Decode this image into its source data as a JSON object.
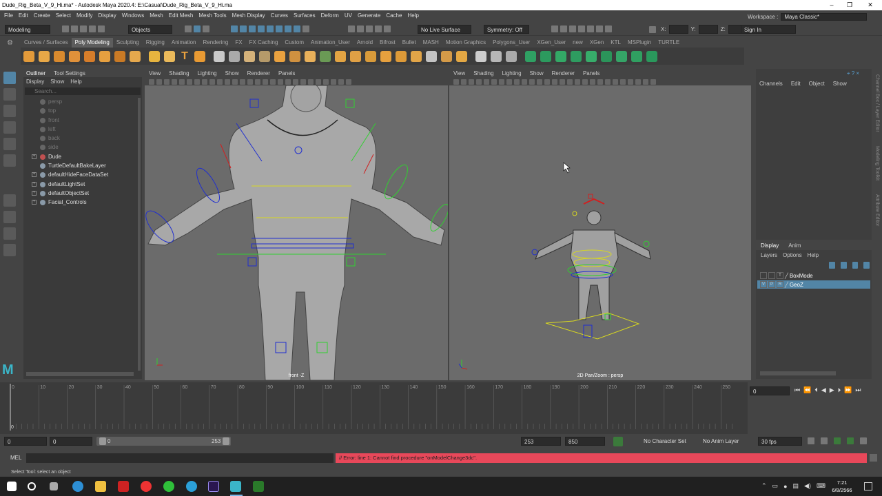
{
  "window": {
    "title": "Dude_Rig_Beta_V_9_Hi.ma* - Autodesk Maya 2020.4: E:\\Casual\\Dude_Rig_Beta_V_9_Hi.ma"
  },
  "menubar": [
    "File",
    "Edit",
    "Create",
    "Select",
    "Modify",
    "Display",
    "Windows",
    "Mesh",
    "Edit Mesh",
    "Mesh Tools",
    "Mesh Display",
    "Curves",
    "Surfaces",
    "Deform",
    "UV",
    "Generate",
    "Cache",
    "Help"
  ],
  "statusline": {
    "mode": "Modeling",
    "select_mode": "Objects",
    "live_surface": "No Live Surface",
    "symmetry": "Symmetry: Off",
    "x_label": "X:",
    "y_label": "Y:",
    "z_label": "Z:",
    "sign_in": "Sign In"
  },
  "workspace": {
    "label": "Workspace :",
    "value": "Maya Classic*"
  },
  "shelf_tabs": [
    "Curves / Surfaces",
    "Poly Modeling",
    "Sculpting",
    "Rigging",
    "Animation",
    "Rendering",
    "FX",
    "FX Caching",
    "Custom",
    "Animation_User",
    "Arnold",
    "Bifrost",
    "Bullet",
    "MASH",
    "Motion Graphics",
    "Polygons_User",
    "XGen_User",
    "new",
    "XGen",
    "KTL",
    "MSPlugin",
    "TURTLE"
  ],
  "outliner": {
    "tabs": [
      "Outliner",
      "Tool Settings"
    ],
    "menu": [
      "Display",
      "Show",
      "Help"
    ],
    "search_placeholder": "Search...",
    "items": [
      {
        "label": "persp",
        "dim": true,
        "expand": false
      },
      {
        "label": "top",
        "dim": true,
        "expand": false
      },
      {
        "label": "front",
        "dim": true,
        "expand": false
      },
      {
        "label": "left",
        "dim": true,
        "expand": false
      },
      {
        "label": "back",
        "dim": true,
        "expand": false
      },
      {
        "label": "side",
        "dim": true,
        "expand": false
      },
      {
        "label": "Dude",
        "dim": false,
        "expand": true
      },
      {
        "label": "TurtleDefaultBakeLayer",
        "dim": false,
        "expand": false
      },
      {
        "label": "defaultHideFaceDataSet",
        "dim": false,
        "expand": true
      },
      {
        "label": "defaultLightSet",
        "dim": false,
        "expand": true
      },
      {
        "label": "defaultObjectSet",
        "dim": false,
        "expand": true
      },
      {
        "label": "Facial_Controls",
        "dim": false,
        "expand": true
      }
    ]
  },
  "viewport_menu": [
    "View",
    "Shading",
    "Lighting",
    "Show",
    "Renderer",
    "Panels"
  ],
  "viewport_left": {
    "label": "front -Z"
  },
  "viewport_right": {
    "label": "2D Pan/Zoom : persp"
  },
  "channelbox": {
    "menu": [
      "Channels",
      "Edit",
      "Object",
      "Show"
    ]
  },
  "layer_editor": {
    "tabs": [
      "Display",
      "Anim"
    ],
    "menu": [
      "Layers",
      "Options",
      "Help"
    ],
    "layers": [
      {
        "v": "",
        "p": "",
        "r": "T",
        "name": "BoxMode",
        "selected": false
      },
      {
        "v": "V",
        "p": "P",
        "r": "R",
        "name": "GeoZ",
        "selected": true
      }
    ]
  },
  "right_sidebar": [
    "Channel Box / Layer Editor",
    "Modeling Toolkit",
    "Attribute Editor"
  ],
  "timeline": {
    "ticks": [
      "0",
      "10",
      "20",
      "30",
      "40",
      "50",
      "60",
      "70",
      "80",
      "90",
      "100",
      "110",
      "120",
      "130",
      "140",
      "150",
      "160",
      "170",
      "180",
      "190",
      "200",
      "210",
      "220",
      "230",
      "240",
      "250"
    ],
    "current_frame": "0"
  },
  "playback": {
    "frame_field": "0"
  },
  "range": {
    "start": "0",
    "playback_start": "0",
    "slider_start": "0",
    "slider_end": "253",
    "playback_end": "253",
    "end": "850",
    "character_set": "No Character Set",
    "anim_layer": "No Anim Layer",
    "fps": "30 fps"
  },
  "cmdline": {
    "label": "MEL",
    "error": "// Error: line 1: Cannot find procedure \"onModelChange3dc\"."
  },
  "helpline": "Select Tool: select an object",
  "taskbar": {
    "time": "7:21",
    "date": "6/8/2566"
  },
  "colors": {
    "error_bg": "#e8485a",
    "selection": "#5285a6",
    "viewport": "#6b6b6b"
  }
}
